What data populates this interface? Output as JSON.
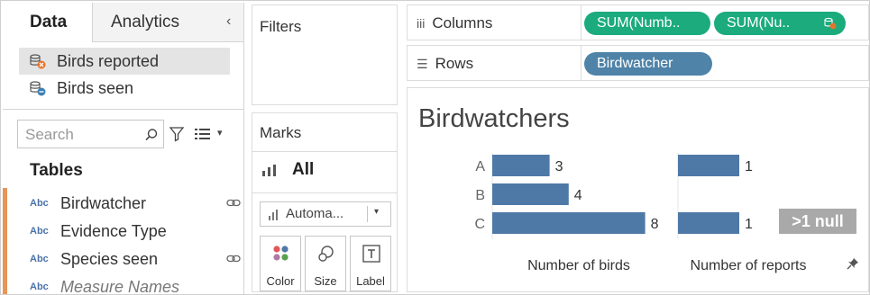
{
  "data_pane": {
    "tabs": [
      "Data",
      "Analytics"
    ],
    "collapse_glyph": "‹",
    "data_sources": [
      {
        "label": "Birds reported",
        "selected": true,
        "icon": "datasource-warning-icon"
      },
      {
        "label": "Birds seen",
        "selected": false,
        "icon": "datasource-link-icon"
      }
    ],
    "search_placeholder": "Search",
    "tables_title": "Tables",
    "fields": [
      {
        "type_tag": "Abc",
        "label": "Birdwatcher",
        "linked": true,
        "italic": false
      },
      {
        "type_tag": "Abc",
        "label": "Evidence Type",
        "linked": false,
        "italic": false
      },
      {
        "type_tag": "Abc",
        "label": "Species seen",
        "linked": true,
        "italic": false
      },
      {
        "type_tag": "Abc",
        "label": "Measure Names",
        "linked": false,
        "italic": true
      }
    ]
  },
  "filters": {
    "title": "Filters"
  },
  "marks": {
    "title": "Marks",
    "all_label": "All",
    "mark_type": "Automa...",
    "cards": [
      "Color",
      "Size",
      "Label"
    ]
  },
  "shelves": {
    "columns_label": "Columns",
    "rows_label": "Rows",
    "column_pills": [
      "SUM(Numb..",
      "SUM(Nu.."
    ],
    "row_pills": [
      "Birdwatcher"
    ]
  },
  "view": {
    "title": "Birdwatchers",
    "null_badge": ">1 null"
  },
  "colors": {
    "bar": "#4e79a7",
    "green_pill": "#1bab7c",
    "blue_pill": "#4f83a8",
    "field_strip": "#e8955a"
  },
  "chart_data": {
    "type": "bar",
    "orientation": "horizontal",
    "categories": [
      "A",
      "B",
      "C"
    ],
    "series": [
      {
        "name": "Number of birds",
        "values": [
          3,
          4,
          8
        ]
      },
      {
        "name": "Number of reports",
        "values": [
          1,
          null,
          1
        ]
      }
    ],
    "xlabels": [
      "Number of birds",
      "Number of reports"
    ],
    "grid": false
  }
}
